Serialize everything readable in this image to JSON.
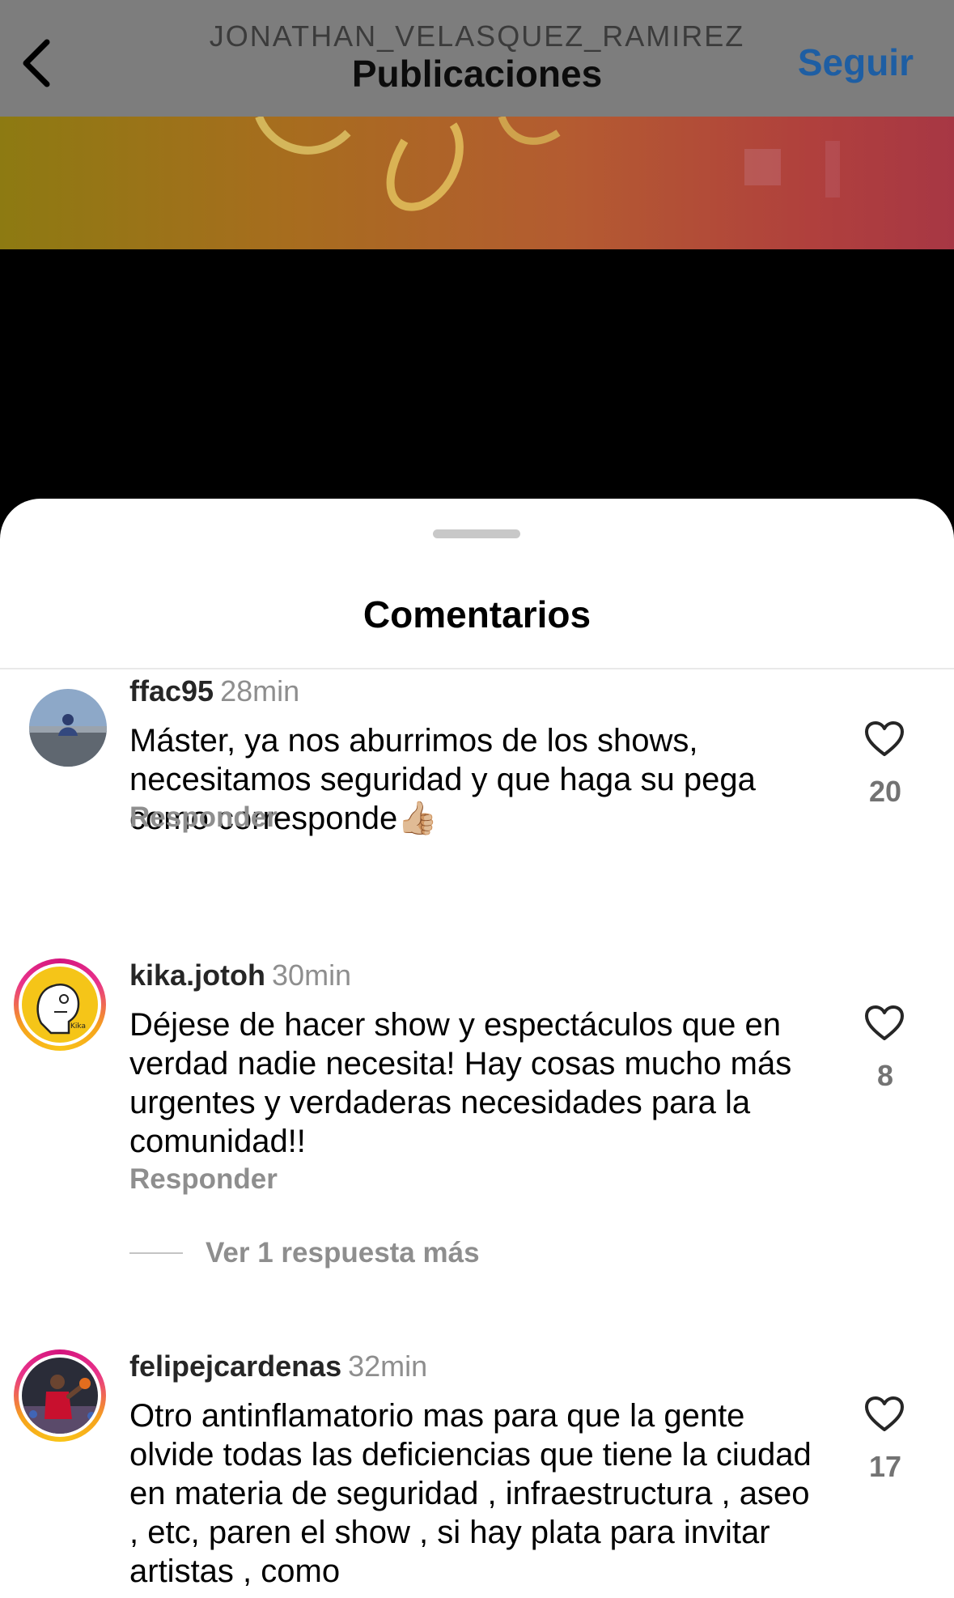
{
  "header": {
    "owner": "JONATHAN_VELASQUEZ_RAMIREZ",
    "title": "Publicaciones",
    "follow_label": "Seguir"
  },
  "sheet": {
    "title": "Comentarios"
  },
  "comments": [
    {
      "username": "ffac95",
      "time": "28min",
      "text": "Máster, ya nos aburrimos de los shows, necesitamos seguridad y que haga su pega como corresponde👍🏼",
      "reply_label": "Responder",
      "likes": "20"
    },
    {
      "username": "kika.jotoh",
      "time": "30min",
      "text": "Déjese de hacer show y espectáculos que en verdad nadie necesita! Hay cosas mucho más urgentes y verdaderas necesidades para la comunidad!!",
      "reply_label": "Responder",
      "likes": "8",
      "more_replies": "Ver 1 respuesta más"
    },
    {
      "username": "felipejcardenas",
      "time": "32min",
      "text": "Otro antinflamatorio mas para que la gente olvide todas las deficiencias que tiene la ciudad en materia de seguridad , infraestructura , aseo , etc, paren el show , si hay plata para invitar artistas , como",
      "likes": "17"
    }
  ],
  "icons": {
    "back": "chevron-left-icon",
    "like": "heart-outline-icon"
  },
  "colors": {
    "follow_blue": "#1e5ea3",
    "secondary_text": "#8e8e8e",
    "story_ring_start": "#d4147e",
    "story_ring_end": "#f9c518"
  }
}
